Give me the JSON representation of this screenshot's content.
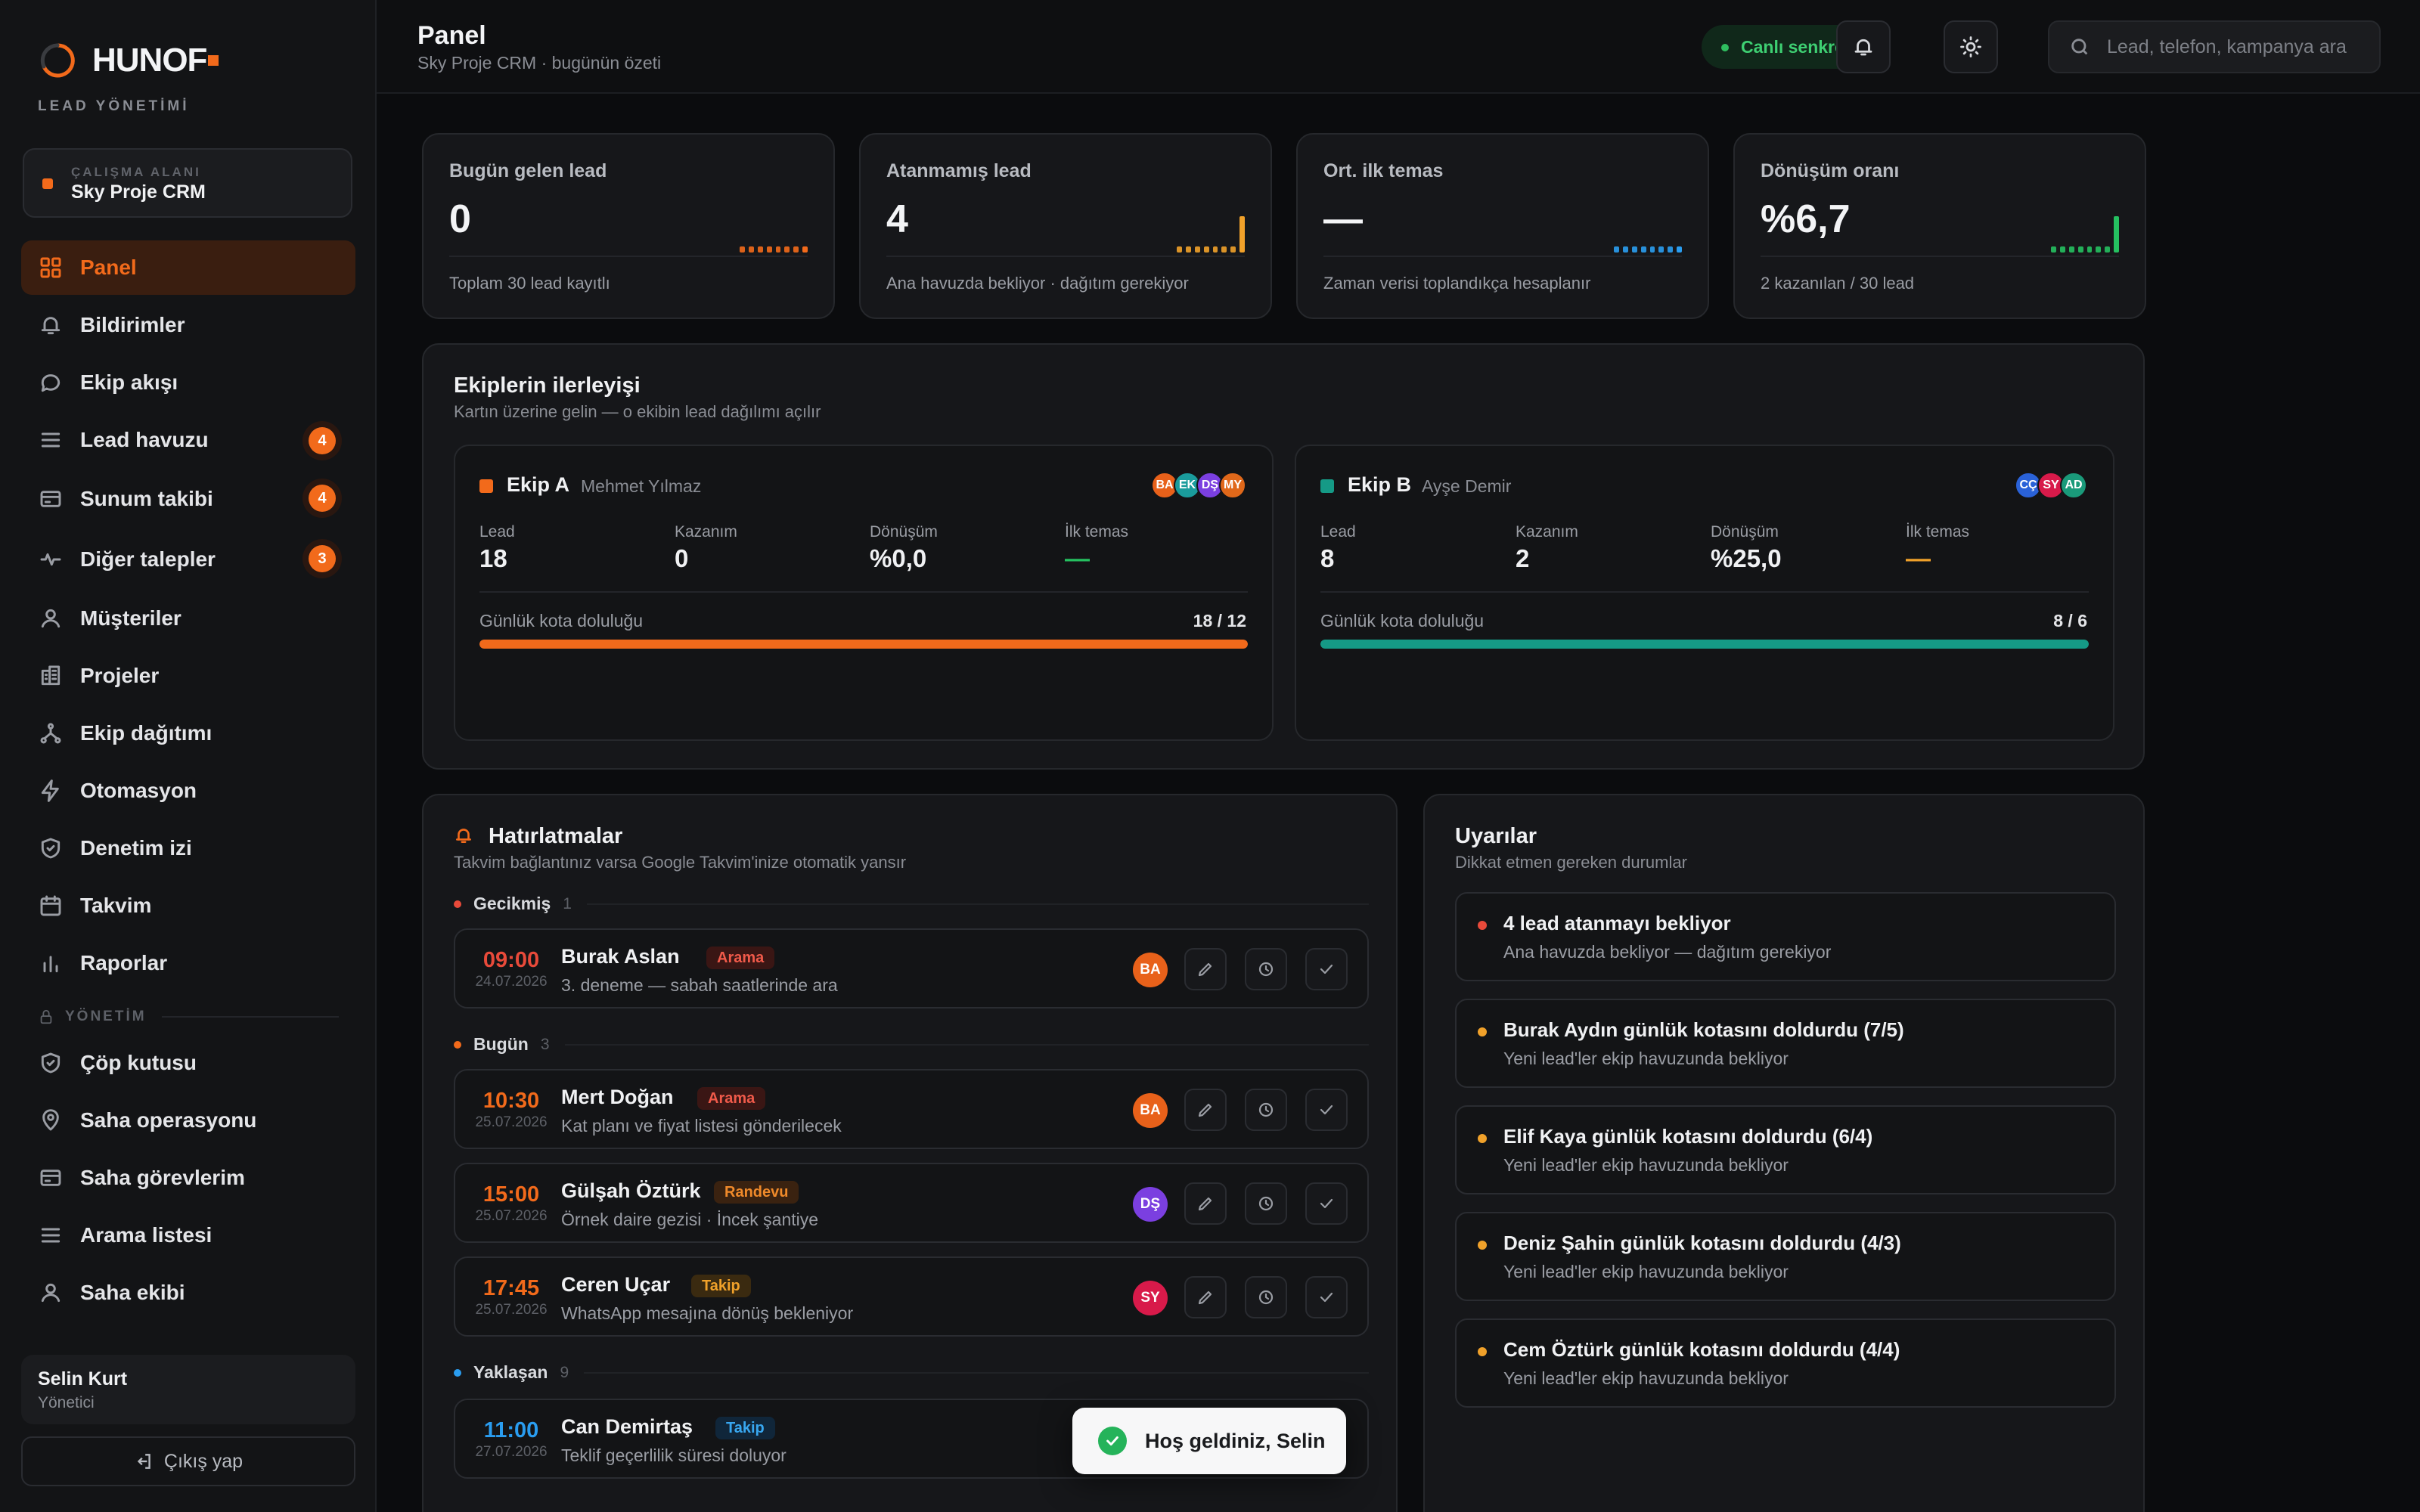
{
  "brand": {
    "name": "HUNOF",
    "subtitle": "LEAD YÖNETİMİ"
  },
  "workspace": {
    "label": "ÇALIŞMA ALANI",
    "name": "Sky Proje CRM"
  },
  "sidebar": {
    "items": [
      {
        "label": "Panel",
        "icon": "grid-icon"
      },
      {
        "label": "Bildirimler",
        "icon": "bell-icon"
      },
      {
        "label": "Ekip akışı",
        "icon": "chat-icon"
      },
      {
        "label": "Lead havuzu",
        "icon": "list-icon",
        "badge": "4"
      },
      {
        "label": "Sunum takibi",
        "icon": "card-icon",
        "badge": "4"
      },
      {
        "label": "Diğer talepler",
        "icon": "pulse-icon",
        "badge": "3"
      },
      {
        "label": "Müşteriler",
        "icon": "user-icon"
      },
      {
        "label": "Projeler",
        "icon": "building-icon"
      },
      {
        "label": "Ekip dağıtımı",
        "icon": "share-icon"
      },
      {
        "label": "Otomasyon",
        "icon": "bolt-icon"
      },
      {
        "label": "Denetim izi",
        "icon": "shield-icon"
      },
      {
        "label": "Takvim",
        "icon": "calendar-icon"
      },
      {
        "label": "Raporlar",
        "icon": "bar-chart-icon"
      }
    ],
    "section_label": "YÖNETİM",
    "admin_items": [
      {
        "label": "Çöp kutusu",
        "icon": "trash-shield-icon"
      },
      {
        "label": "Saha operasyonu",
        "icon": "pin-icon"
      },
      {
        "label": "Saha görevlerim",
        "icon": "card-icon"
      },
      {
        "label": "Arama listesi",
        "icon": "list-icon"
      },
      {
        "label": "Saha ekibi",
        "icon": "user-icon"
      }
    ]
  },
  "user": {
    "name": "Selin Kurt",
    "role": "Yönetici"
  },
  "logout_label": "Çıkış yap",
  "header": {
    "title": "Panel",
    "subtitle": "Sky Proje CRM · bugünün özeti",
    "sync_label": "Canlı senkron",
    "search_placeholder": "Lead, telefon, kampanya ara"
  },
  "stats": [
    {
      "label": "Bugün gelen lead",
      "value": "0",
      "foot": "Toplam 30 lead kayıtlı",
      "color": "#f26a1b"
    },
    {
      "label": "Atanmamış lead",
      "value": "4",
      "foot": "Ana havuzda bekliyor · dağıtım gerekiyor",
      "color": "#f0a12a"
    },
    {
      "label": "Ort. ilk temas",
      "value": "—",
      "foot": "Zaman verisi toplandıkça hesaplanır",
      "color": "#2a9df0"
    },
    {
      "label": "Dönüşüm oranı",
      "value": "%6,7",
      "foot": "2 kazanılan / 30 lead",
      "color": "#25c060"
    }
  ],
  "teams_section": {
    "title": "Ekiplerin ilerleyişi",
    "subtitle": "Kartın üzerine gelin — o ekibin lead dağılımı açılır",
    "teams": [
      {
        "name": "Ekip A",
        "lead_name": "Mehmet Yılmaz",
        "color": "#f26a1b",
        "avatars": [
          {
            "initials": "BA",
            "color": "#e8611a"
          },
          {
            "initials": "EK",
            "color": "#1a9c9c"
          },
          {
            "initials": "DŞ",
            "color": "#7b3fe0"
          },
          {
            "initials": "MY",
            "color": "#e0681a"
          }
        ],
        "stats": [
          {
            "label": "Lead",
            "value": "18"
          },
          {
            "label": "Kazanım",
            "value": "0"
          },
          {
            "label": "Dönüşüm",
            "value": "%0,0"
          },
          {
            "label": "İlk temas",
            "value": "—"
          }
        ],
        "quota_label": "Günlük kota doluluğu",
        "quota_value": "18 / 12",
        "quota_fill": 1.0
      },
      {
        "name": "Ekip B",
        "lead_name": "Ayşe Demir",
        "color": "#159a86",
        "avatars": [
          {
            "initials": "CÇ",
            "color": "#2a62d8"
          },
          {
            "initials": "SY",
            "color": "#d81a4a"
          },
          {
            "initials": "AD",
            "color": "#1a9a7a"
          }
        ],
        "stats": [
          {
            "label": "Lead",
            "value": "8"
          },
          {
            "label": "Kazanım",
            "value": "2"
          },
          {
            "label": "Dönüşüm",
            "value": "%25,0"
          },
          {
            "label": "İlk temas",
            "value": "—"
          }
        ],
        "quota_label": "Günlük kota doluluğu",
        "quota_value": "8 / 6",
        "quota_fill": 1.0
      }
    ]
  },
  "reminders": {
    "title": "Hatırlatmalar",
    "subtitle": "Takvim bağlantınız varsa Google Takvim'inize otomatik yansır",
    "groups": [
      {
        "label": "Gecikmiş",
        "count": "1",
        "color": "#e84a3a"
      },
      {
        "label": "Bugün",
        "count": "3",
        "color": "#f26a1b"
      },
      {
        "label": "Yaklaşan",
        "count": "9",
        "color": "#2a9df0"
      }
    ],
    "items": [
      {
        "time": "09:00",
        "date": "24.07.2026",
        "name": "Burak Aslan",
        "tag": "Arama",
        "note": "3. deneme — sabah saatlerinde ara",
        "avatar": "BA",
        "avatar_color": "#e8611a",
        "time_color": "#e84a3a"
      },
      {
        "time": "10:30",
        "date": "25.07.2026",
        "name": "Mert Doğan",
        "tag": "Arama",
        "note": "Kat planı ve fiyat listesi gönderilecek",
        "avatar": "BA",
        "avatar_color": "#e8611a",
        "time_color": "#f26a1b"
      },
      {
        "time": "15:00",
        "date": "25.07.2026",
        "name": "Gülşah Öztürk",
        "tag": "Randevu",
        "note": "Örnek daire gezisi · İncek şantiye",
        "avatar": "DŞ",
        "avatar_color": "#7b3fe0",
        "time_color": "#f26a1b"
      },
      {
        "time": "17:45",
        "date": "25.07.2026",
        "name": "Ceren Uçar",
        "tag": "Takip",
        "note": "WhatsApp mesajına dönüş bekleniyor",
        "avatar": "SY",
        "avatar_color": "#d81a4a",
        "time_color": "#f26a1b"
      },
      {
        "time": "11:00",
        "date": "27.07.2026",
        "name": "Can Demirtaş",
        "tag": "Takip",
        "note": "Teklif geçerlilik süresi doluyor",
        "avatar": "",
        "avatar_color": "#2a62d8",
        "time_color": "#2a9df0"
      }
    ]
  },
  "alerts": {
    "title": "Uyarılar",
    "subtitle": "Dikkat etmen gereken durumlar",
    "items": [
      {
        "title": "4 lead atanmayı bekliyor",
        "sub": "Ana havuzda bekliyor — dağıtım gerekiyor",
        "color": "#e84a3a"
      },
      {
        "title": "Burak Aydın günlük kotasını doldurdu (7/5)",
        "sub": "Yeni lead'ler ekip havuzunda bekliyor",
        "color": "#f0a12a"
      },
      {
        "title": "Elif Kaya günlük kotasını doldurdu (6/4)",
        "sub": "Yeni lead'ler ekip havuzunda bekliyor",
        "color": "#f0a12a"
      },
      {
        "title": "Deniz Şahin günlük kotasını doldurdu (4/3)",
        "sub": "Yeni lead'ler ekip havuzunda bekliyor",
        "color": "#f0a12a"
      },
      {
        "title": "Cem Öztürk günlük kotasını doldurdu (4/4)",
        "sub": "Yeni lead'ler ekip havuzunda bekliyor",
        "color": "#f0a12a"
      }
    ]
  },
  "toast": {
    "message": "Hoş geldiniz, Selin"
  },
  "accent": "#f26a1b"
}
